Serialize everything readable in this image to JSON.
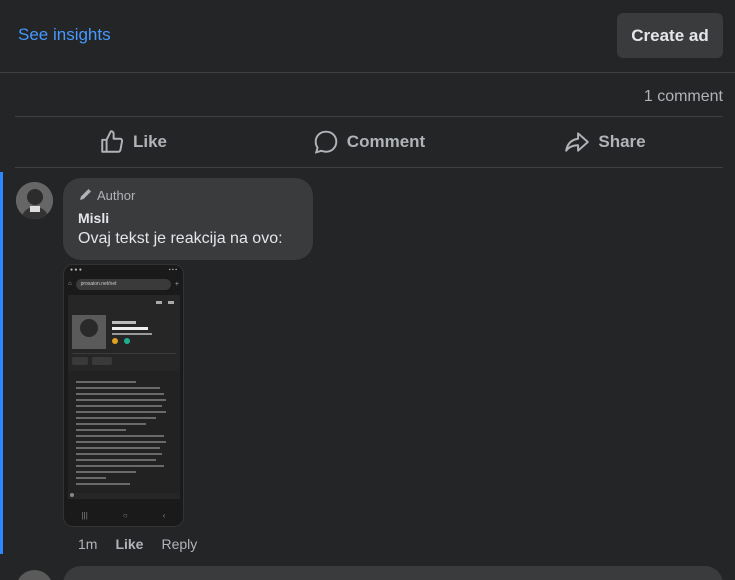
{
  "header": {
    "see_insights": "See insights",
    "create_ad": "Create ad"
  },
  "post": {
    "comment_count": "1 comment",
    "actions": [
      {
        "label": "Like",
        "icon": "thumbs-up-icon"
      },
      {
        "label": "Comment",
        "icon": "comment-bubble-icon"
      },
      {
        "label": "Share",
        "icon": "share-arrow-icon"
      }
    ]
  },
  "comment": {
    "badge": "Author",
    "badge_icon": "pen-icon",
    "author": "Misli",
    "text": "Ovaj tekst je reakcija na ovo:",
    "time": "1m",
    "like": "Like",
    "reply": "Reply"
  },
  "attachment": {
    "url": "prosaion.net/net"
  },
  "colors": {
    "background": "#242526",
    "surface": "#3a3b3c",
    "link": "#4599ff",
    "thread_accent": "#2d88ff",
    "muted_text": "#b0b3b8"
  }
}
